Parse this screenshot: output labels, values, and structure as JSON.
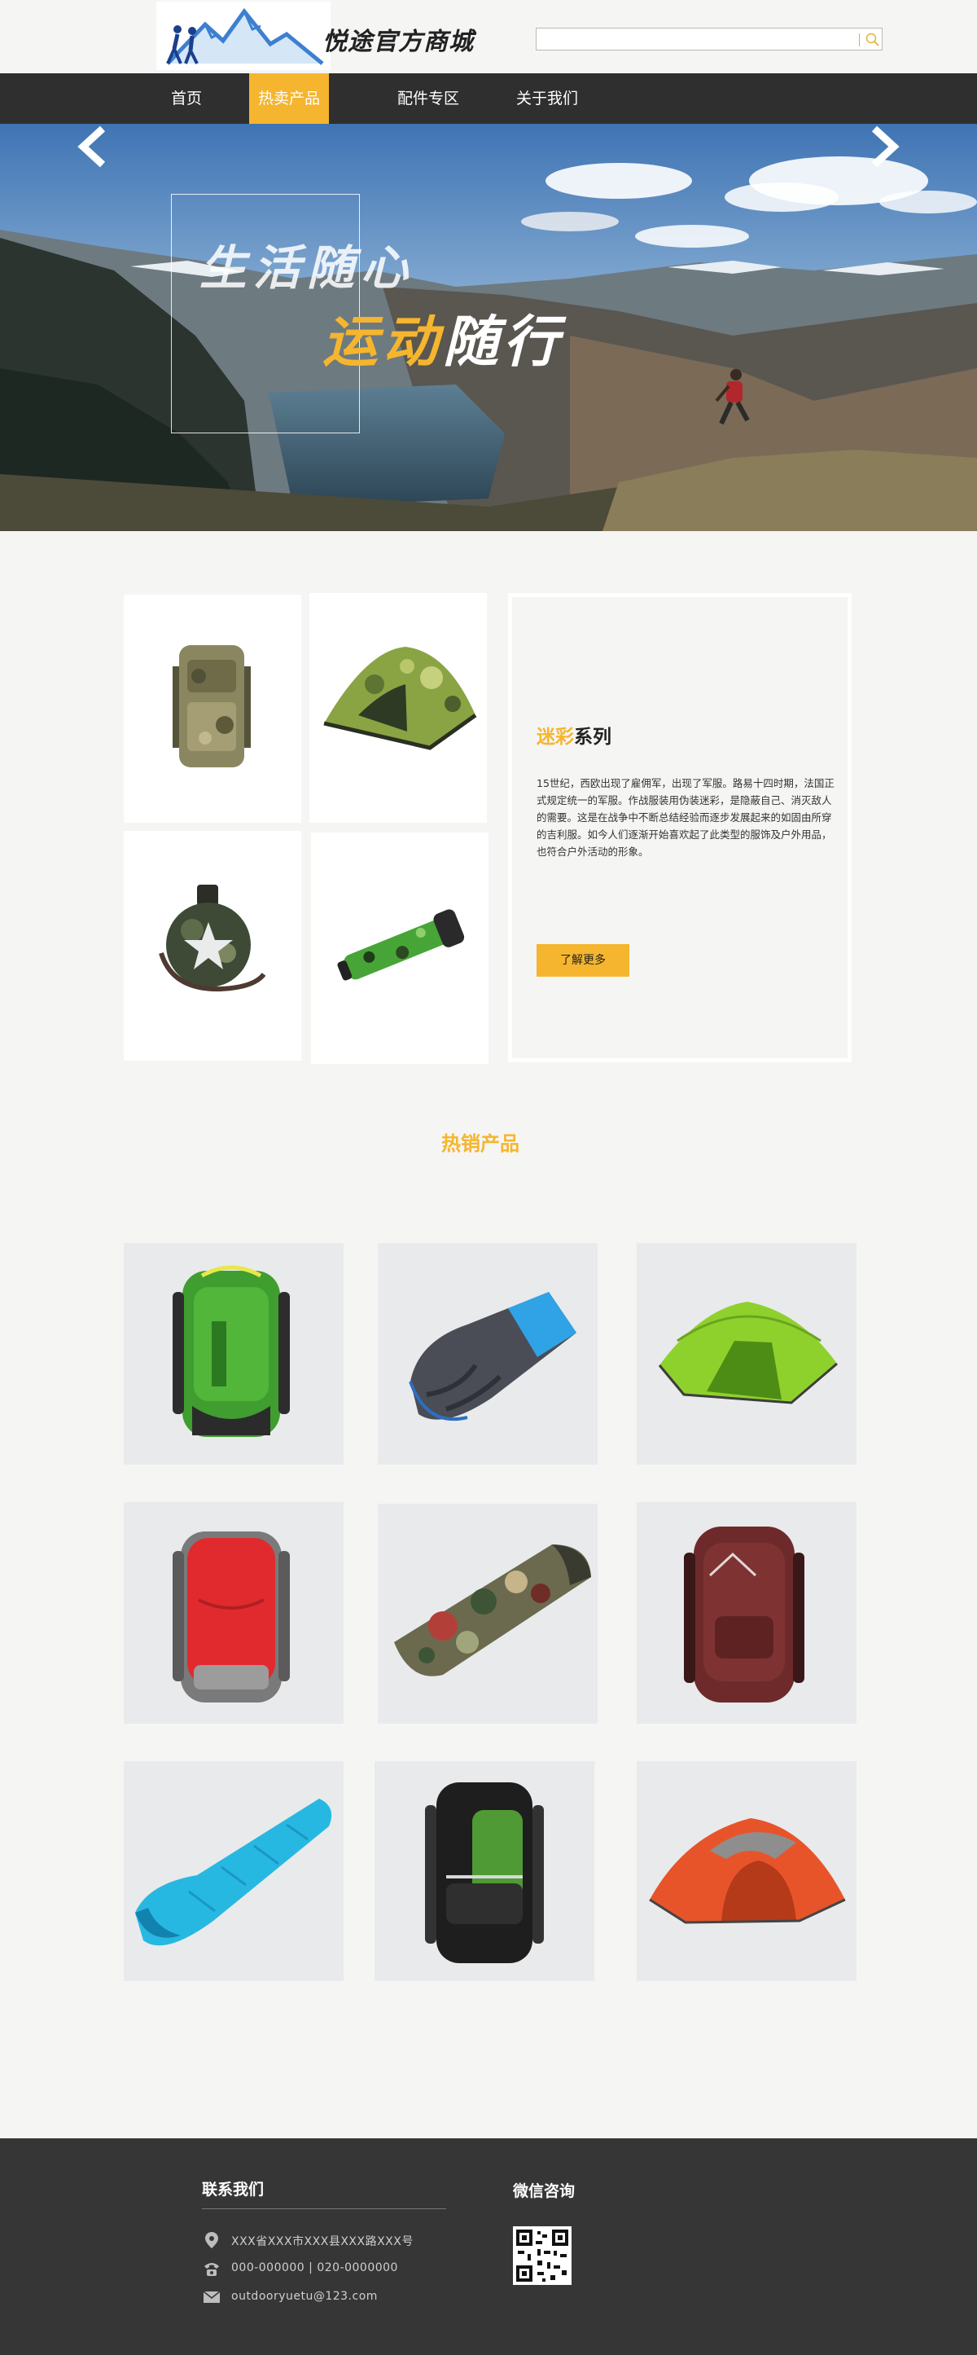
{
  "header": {
    "logo_text": "悦途",
    "site_title": "悦途官方商城",
    "search": {
      "placeholder": "",
      "value": ""
    }
  },
  "nav": {
    "items": [
      {
        "label": "首页",
        "active": false
      },
      {
        "label": "热卖产品",
        "active": true
      },
      {
        "label": "配件专区",
        "active": false
      },
      {
        "label": "关于我们",
        "active": false
      }
    ]
  },
  "banner": {
    "slogan_line1": "生活随心",
    "slogan_line2_highlight": "运动",
    "slogan_line2_rest": "随行"
  },
  "camo": {
    "title_highlight": "迷彩",
    "title_rest": "系列",
    "description": "15世纪，西欧出现了雇佣军，出现了军服。路易十四时期，法国正式规定统一的军服。作战服装用伪装迷彩，是隐蔽自己、消灭敌人的需要。这是在战争中不断总结经验而逐步发展起来的如固由所穿的吉利服。如今人们逐渐开始喜欢起了此类型的服饰及户外用品，也符合户外活动的形象。",
    "more_label": "了解更多",
    "tiles": [
      "camo-backpack",
      "camo-tent",
      "camo-canteen",
      "camo-flashlight"
    ]
  },
  "hot": {
    "title": "热销产品",
    "products": [
      "green-backpack",
      "blue-sleeping-bag",
      "green-tent",
      "red-backpack",
      "camo-sleeping-bag",
      "maroon-backpack",
      "cyan-sleeping-bag",
      "black-green-backpack",
      "orange-tent"
    ]
  },
  "footer": {
    "contact_title": "联系我们",
    "address": "XXX省XXX市XXX县XXX路XXX号",
    "phone": "000-000000   |   020-0000000",
    "email": "outdooryuetu@123.com",
    "wechat_title": "微信咨询"
  },
  "colors": {
    "accent": "#f5b52e",
    "nav_bg": "#2f2f2f",
    "footer_bg": "#363636",
    "page_bg": "#f5f5f4"
  }
}
